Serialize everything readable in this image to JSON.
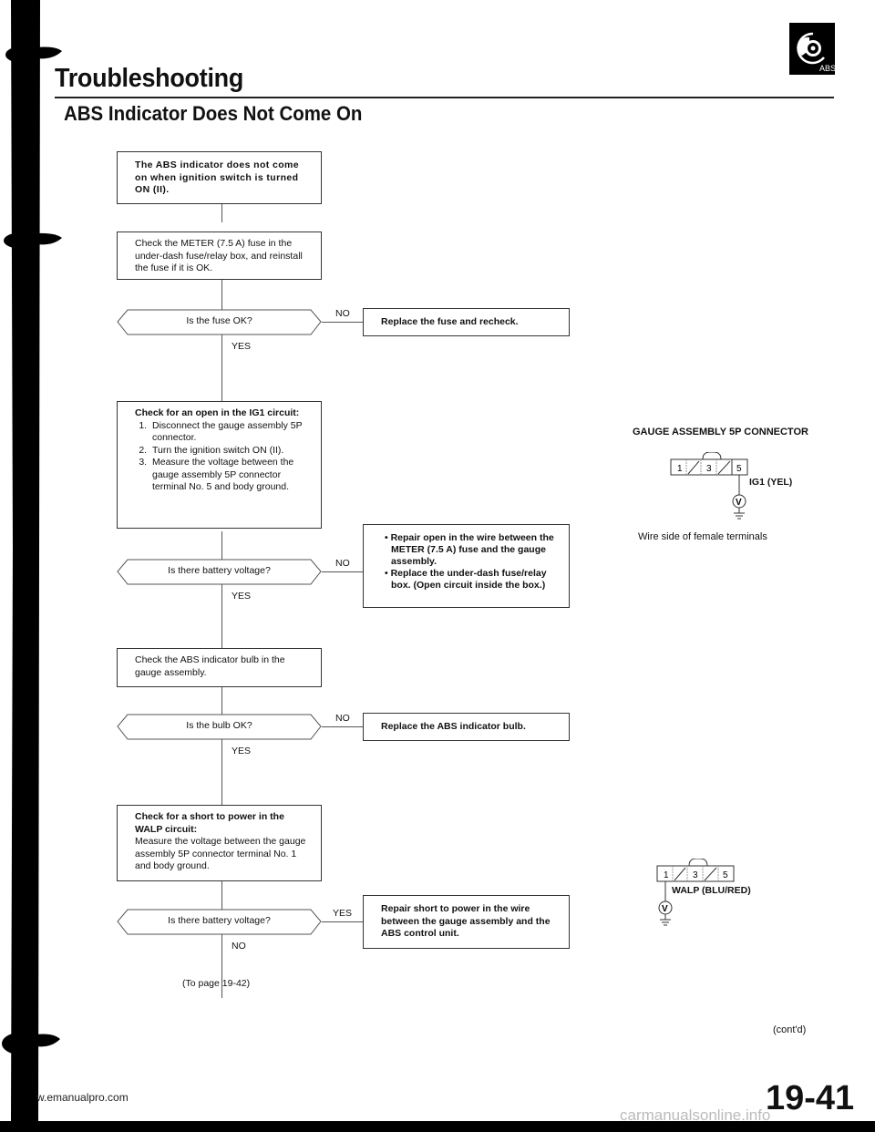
{
  "header": {
    "title": "Troubleshooting",
    "section_title": "ABS Indicator Does Not Come On",
    "icon_label": "ABS"
  },
  "flowchart": {
    "start": "The ABS indicator does not come on when ignition switch is turned ON (II).",
    "step1": "Check the METER (7.5 A) fuse in the under-dash fuse/relay box, and reinstall the fuse if it is OK.",
    "q1": "Is the fuse OK?",
    "q1_no_action": "Replace the fuse and recheck.",
    "step2": {
      "heading": "Check for an open in the IG1 circuit:",
      "items": [
        "Disconnect the gauge assembly 5P connector.",
        "Turn the ignition switch ON (II).",
        "Measure the voltage between the gauge assembly 5P connector terminal No. 5 and body ground."
      ]
    },
    "q2": "Is there battery voltage?",
    "q2_no_action": [
      "Repair open in the wire between the METER (7.5 A) fuse and the gauge assembly.",
      "Replace the under-dash fuse/relay box. (Open circuit inside the box.)"
    ],
    "step3": "Check the ABS indicator bulb in the gauge assembly.",
    "q3": "Is the bulb OK?",
    "q3_no_action": "Replace the ABS indicator bulb.",
    "step4": {
      "heading": "Check for a short to power in the WALP circuit:",
      "body": "Measure the voltage between the gauge assembly 5P connector terminal No. 1 and body ground."
    },
    "q4": "Is there battery voltage?",
    "q4_yes_action": "Repair short to power in the wire between the gauge assembly and the ABS control unit.",
    "labels": {
      "yes": "YES",
      "no": "NO"
    },
    "continue_ref": "(To page 19-42)"
  },
  "connector1": {
    "title": "GAUGE ASSEMBLY 5P CONNECTOR",
    "pins": [
      "1",
      "3",
      "5"
    ],
    "wire_label": "IG1 (YEL)",
    "meter": "V",
    "caption": "Wire side of female terminals"
  },
  "connector2": {
    "pins": [
      "1",
      "3",
      "5"
    ],
    "wire_label": "WALP (BLU/RED)",
    "meter": "V"
  },
  "footer": {
    "continued": "(cont'd)",
    "page_number": "19-41",
    "watermark_left": "w.emanualpro.com",
    "watermark_right": "carmanualsonline.info"
  }
}
